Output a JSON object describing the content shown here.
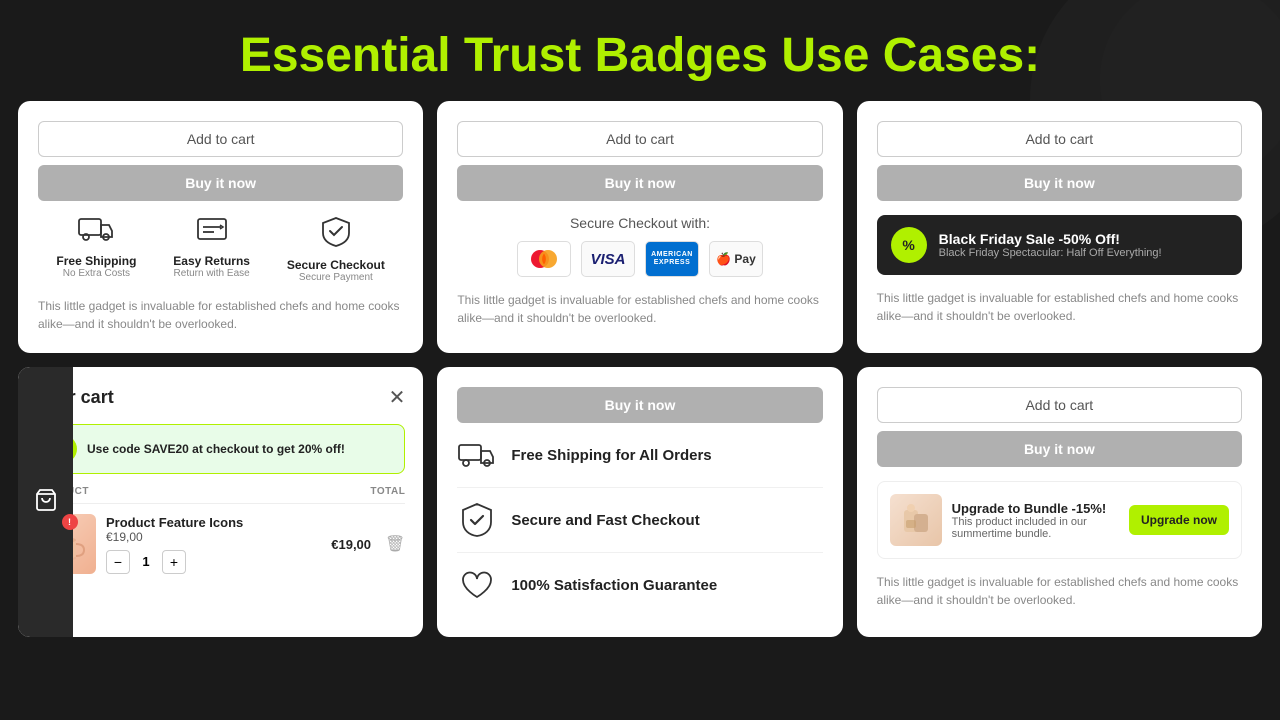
{
  "page": {
    "title_white": "Essential Trust Badges",
    "title_green": "Use Cases:"
  },
  "card1": {
    "add_to_cart": "Add to cart",
    "buy_now": "Buy it now",
    "badge1_title": "Free Shipping",
    "badge1_sub": "No Extra Costs",
    "badge2_title": "Easy Returns",
    "badge2_sub": "Return with Ease",
    "badge3_title": "Secure Checkout",
    "badge3_sub": "Secure Payment",
    "description": "This little gadget is invaluable for established chefs and home cooks alike—and it shouldn't be overlooked."
  },
  "card2": {
    "add_to_cart": "Add to cart",
    "buy_now": "Buy it now",
    "secure_label": "Secure Checkout with:",
    "description": "This little gadget is invaluable for established chefs and home cooks alike—and it shouldn't be overlooked."
  },
  "card3": {
    "add_to_cart": "Add to cart",
    "buy_now": "Buy it now",
    "banner_title": "Black Friday Sale -50% Off!",
    "banner_sub": "Black Friday Spectacular: Half Off Everything!",
    "description": "This little gadget is invaluable for established chefs and home cooks alike—and it shouldn't be overlooked."
  },
  "card4": {
    "cart_title": "Your cart",
    "promo_text": "Use code SAVE20 at checkout to get 20% off!",
    "col_product": "PRODUCT",
    "col_total": "TOTAL",
    "item_name": "Product Feature Icons",
    "item_price": "€19,00",
    "item_qty": 1,
    "item_total": "€19,00"
  },
  "card5": {
    "buy_now": "Buy it now",
    "feature1": "Free Shipping for All Orders",
    "feature2": "Secure and Fast Checkout",
    "feature3": "100% Satisfaction Guarantee"
  },
  "card6": {
    "add_to_cart": "Add to cart",
    "buy_now": "Buy it now",
    "bundle_title": "Upgrade to Bundle -15%!",
    "bundle_sub": "This product included in our summertime bundle.",
    "upgrade_btn": "Upgrade now",
    "description": "This little gadget is invaluable for established chefs and home cooks alike—and it shouldn't be overlooked."
  }
}
